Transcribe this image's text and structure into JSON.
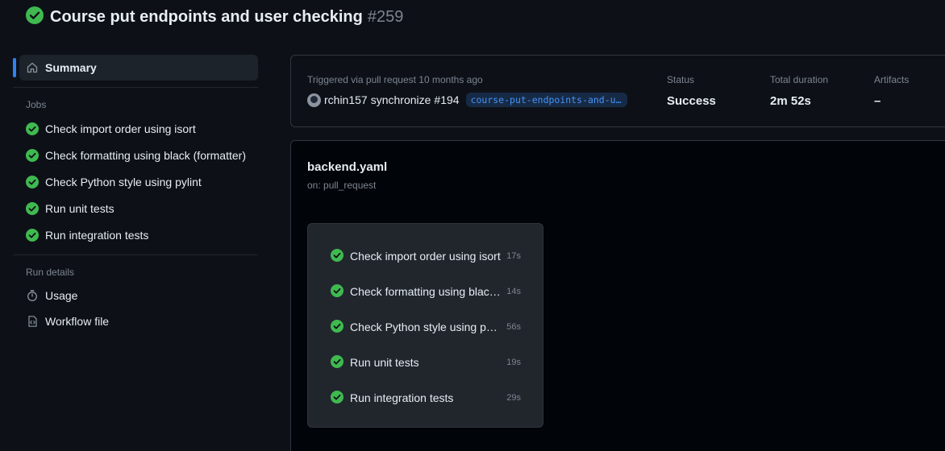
{
  "run": {
    "title": "Course put endpoints and user checking",
    "number": "#259"
  },
  "sidebar": {
    "summary_label": "Summary",
    "jobs_heading": "Jobs",
    "jobs": [
      {
        "label": "Check import order using isort"
      },
      {
        "label": "Check formatting using black (formatter)"
      },
      {
        "label": "Check Python style using pylint"
      },
      {
        "label": "Run unit tests"
      },
      {
        "label": "Run integration tests"
      }
    ],
    "details_heading": "Run details",
    "usage_label": "Usage",
    "workflow_file_label": "Workflow file"
  },
  "summary": {
    "trigger_text": "Triggered via pull request 10 months ago",
    "actor": "rchin157",
    "action": "synchronize",
    "pr": "#194",
    "branch": "course-put-endpoints-and-user-checking",
    "status_label": "Status",
    "status_value": "Success",
    "duration_label": "Total duration",
    "duration_value": "2m 52s",
    "artifacts_label": "Artifacts",
    "artifacts_value": "–"
  },
  "workflow": {
    "name": "backend.yaml",
    "trigger": "on: pull_request",
    "jobs": [
      {
        "label": "Check import order using isort",
        "time": "17s"
      },
      {
        "label": "Check formatting using black (formatter)",
        "time": "14s"
      },
      {
        "label": "Check Python style using pylint",
        "time": "56s"
      },
      {
        "label": "Run unit tests",
        "time": "19s"
      },
      {
        "label": "Run integration tests",
        "time": "29s"
      }
    ]
  },
  "colors": {
    "success": "#3fb950",
    "accent": "#2f81f7",
    "background": "#0d1117"
  },
  "icons": [
    "check-circle-icon",
    "home-icon",
    "stopwatch-icon",
    "workflow-file-icon"
  ]
}
